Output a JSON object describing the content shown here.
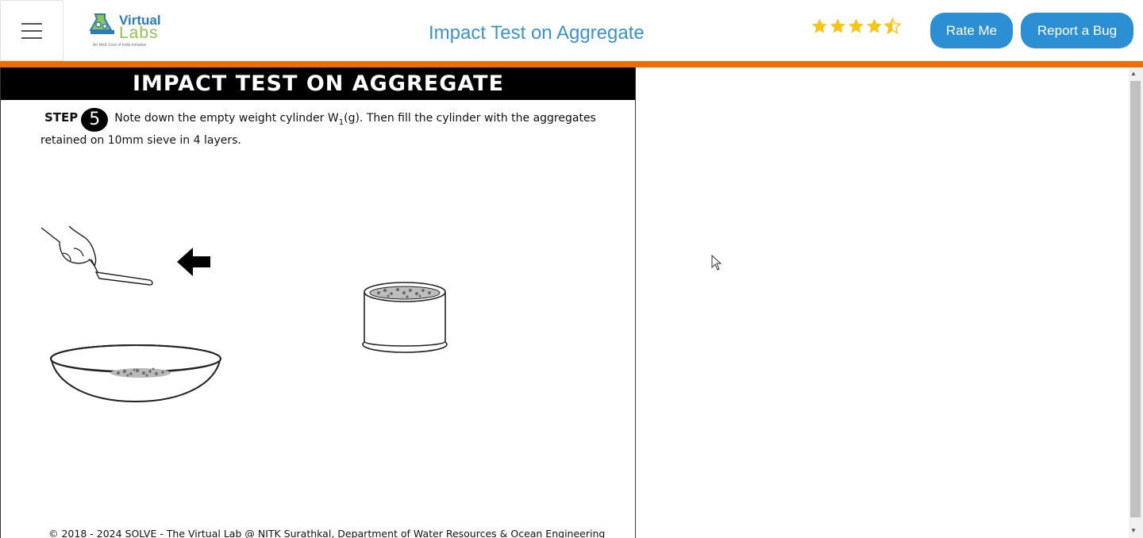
{
  "header": {
    "logo_line1": "Virtual",
    "logo_line2": "Labs",
    "logo_tagline": "An MoE Govt of India Initiative",
    "title": "Impact Test on Aggregate",
    "rating": 4.5,
    "rate_button": "Rate Me",
    "bug_button": "Report a Bug"
  },
  "simulation": {
    "title": "IMPACT TEST ON AGGREGATE",
    "step_label": "STEP",
    "step_number": "5",
    "instruction_part1": "Note down the empty weight cylinder W",
    "instruction_sub": "1",
    "instruction_part2": "(g). Then fill the cylinder with the aggregates retained on 10mm sieve in 4 layers.",
    "footer": "© 2018 - 2024 SOLVE - The Virtual Lab @ NITK Surathkal, Department of Water Resources & Ocean Engineering"
  },
  "colors": {
    "accent_blue": "#2d8fd3",
    "title_blue": "#3a93c9",
    "orange_bar": "#ef6c00",
    "star_gold": "#f5c518"
  }
}
